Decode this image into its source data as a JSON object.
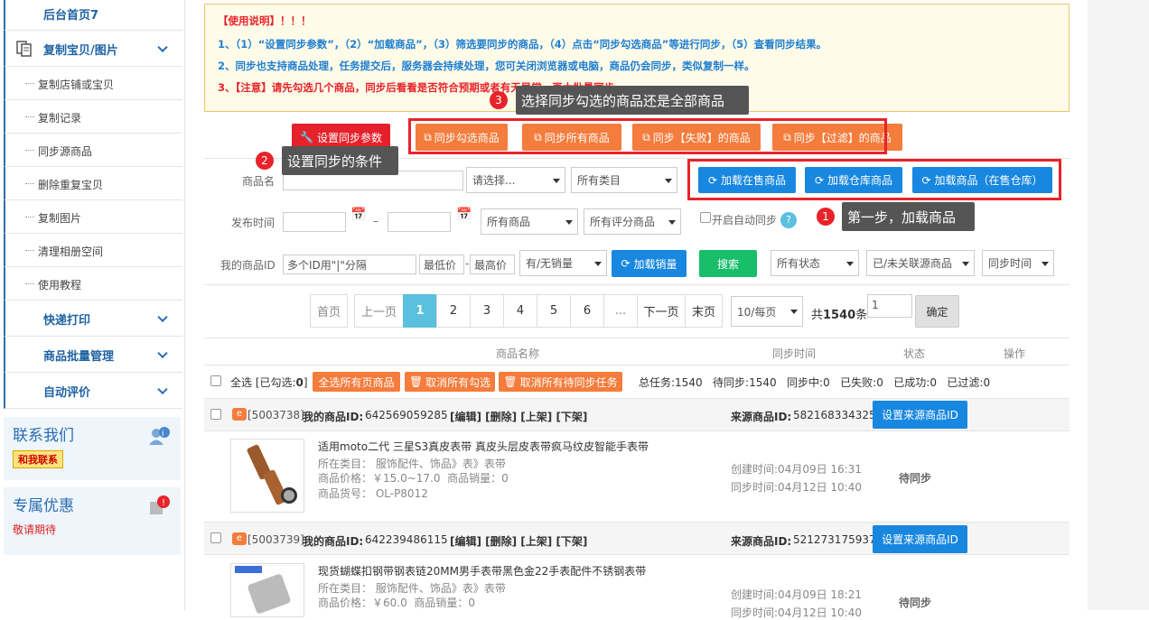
{
  "sidebar": {
    "home": "后台首页7",
    "copy_group": "复制宝贝/图片",
    "copy_items": [
      "复制店铺或宝贝",
      "复制记录",
      "同步源商品",
      "删除重复宝贝",
      "复制图片",
      "清理相册空间",
      "使用教程"
    ],
    "express": "快递打印",
    "batch": "商品批量管理",
    "review": "自动评价",
    "contact_title": "联系我们",
    "contact_btn": "和我联系",
    "promo_title": "专属优惠",
    "promo_text": "敬请期待"
  },
  "notice": {
    "title": "【使用说明】！！！",
    "line1": "1、（1）“设置同步参数”，（2）“加载商品”，（3）筛选要同步的商品，（4）点击“同步勾选商品”等进行同步，（5）查看同步结果。",
    "line2": "2、同步也支持商品处理，任务提交后，服务器会持续处理，您可关闭浏览器或电脑，商品仍会同步，类似复制一样。",
    "line3": "3、【注意】请先勾选几个商品，同步后看看是否符合预期或者有无异常，再大批量同步"
  },
  "tips": {
    "t1": "第一步，加载商品",
    "t2": "设置同步的条件",
    "t3": "选择同步勾选的商品还是全部商品",
    "n1": "1",
    "n2": "2",
    "n3": "3"
  },
  "actions": {
    "settings": "设置同步参数",
    "sync_checked": "同步勾选商品",
    "sync_all": "同步所有商品",
    "sync_failed": "同步【失败】的商品",
    "sync_filtered": "同步【过滤】的商品",
    "load_onsale": "加载在售商品",
    "load_warehouse": "加载仓库商品",
    "load_both": "加载商品（在售仓库）"
  },
  "filters": {
    "name_label": "商品名",
    "select_placeholder": "请选择...",
    "category": "所有类目",
    "date_label": "发布时间",
    "date_sep": "–",
    "all_goods": "所有商品",
    "all_ratings": "所有评分商品",
    "auto_sync": "开启自动同步",
    "id_label": "我的商品ID",
    "id_placeholder": "多个ID用\"|\"分隔",
    "min_price": "最低价",
    "price_sep": "-",
    "max_price": "最高价",
    "sales": "有/无销量",
    "load_sales": "加载销量",
    "search": "搜索",
    "status": "所有状态",
    "relation": "已/未关联源商品",
    "sync_time": "同步时间"
  },
  "pager": {
    "first": "首页",
    "prev": "上一页",
    "pages": [
      "1",
      "2",
      "3",
      "4",
      "5",
      "6",
      "..."
    ],
    "next": "下一页",
    "last": "末页",
    "per_page": "10/每页",
    "total_prefix": "共",
    "total": "1540",
    "total_suffix": "条",
    "goto": "1",
    "confirm": "确定"
  },
  "table": {
    "col_name": "商品名称",
    "col_time": "同步时间",
    "col_status": "状态",
    "col_ops": "操作",
    "select_all": "全选 [已勾选:",
    "checked": "0",
    "select_all_end": "]",
    "btn_select_page": "全选所有页商品",
    "btn_cancel_all": "取消所有勾选",
    "btn_cancel_tasks": "取消所有待同步任务",
    "stats": "总任务:1540   待同步:1540   同步中:0   已失败:0   已成功:0   已过滤:0"
  },
  "items": [
    {
      "code": "[5003738]",
      "id_label": "我的商品ID:",
      "id": "642569059285",
      "ops": "[编辑] [删除] [上架] [下架]",
      "src_label": "来源商品ID:",
      "src_id": "582168334325",
      "src_btn": "设置来源商品ID",
      "title": "适用moto二代 三星S3真皮表带 真皮头层皮表带疯马纹皮智能手表带",
      "category": "所在类目： 服饰配件、饰品》表》表带",
      "price": "商品价格：￥15.0~17.0  商品销量：0",
      "sku": "商品货号： OL-P8012",
      "created": "创建时间:04月09日 16:31",
      "synced": "同步时间:04月12日 10:40",
      "status": "待同步"
    },
    {
      "code": "[5003739]",
      "id_label": "我的商品ID:",
      "id": "642239486115",
      "ops": "[编辑] [删除] [上架] [下架]",
      "src_label": "来源商品ID:",
      "src_id": "521273175937",
      "src_btn": "设置来源商品ID",
      "title": "现货蝴蝶扣钢带钢表链20MM男手表带黑色金22手表配件不锈钢表带",
      "category": "所在类目： 服饰配件、饰品》表》表带",
      "price": "商品价格：￥60.0  商品销量：0",
      "created": "创建时间:04月09日 18:21",
      "synced": "同步时间:04月12日 10:40",
      "status": "待同步"
    }
  ]
}
